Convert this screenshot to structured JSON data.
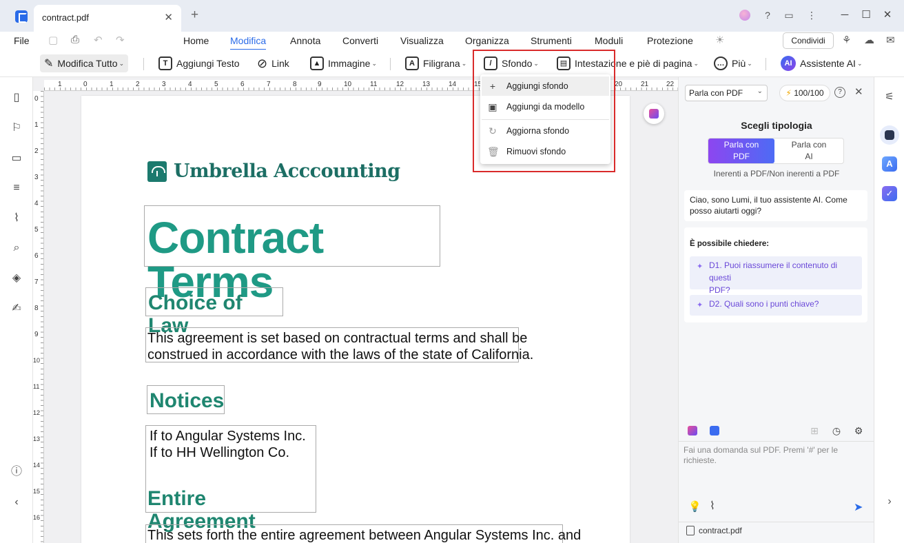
{
  "window": {
    "tab_title": "contract.pdf",
    "tab_close": "✕",
    "tab_add": "+"
  },
  "menu": {
    "file": "File",
    "items": [
      "Home",
      "Modifica",
      "Annota",
      "Converti",
      "Visualizza",
      "Organizza",
      "Strumenti",
      "Moduli",
      "Protezione"
    ],
    "active": "Modifica",
    "share": "Condividi"
  },
  "toolbar": {
    "edit_all": "Modifica Tutto",
    "add_text": "Aggiungi Testo",
    "link": "Link",
    "image": "Immagine",
    "watermark": "Filigrana",
    "background": "Sfondo",
    "header_footer": "Intestazione e piè di pagina",
    "more": "Più",
    "ai_badge": "AI",
    "ai_assistant": "Assistente AI"
  },
  "dropdown": {
    "items": [
      "Aggiungi sfondo",
      "Aggiungi da modello",
      "Aggiorna sfondo",
      "Rimuovi sfondo"
    ]
  },
  "ruler": {
    "h_labels": [
      "1",
      "0",
      "1",
      "2",
      "3",
      "4",
      "5",
      "6",
      "7",
      "8",
      "9",
      "10",
      "11",
      "12",
      "13",
      "14",
      "15",
      "20",
      "21",
      "22"
    ],
    "v_labels": [
      "0",
      "1",
      "2",
      "3",
      "4",
      "5",
      "6",
      "7",
      "8",
      "9",
      "10",
      "11",
      "12",
      "13",
      "14",
      "15",
      "16"
    ]
  },
  "document": {
    "brand": "Umbrella Acccounting",
    "title": "Contract Terms",
    "section1_heading": "Choice of Law",
    "section1_line1": "This agreement is set based on contractual terms and shall be",
    "section1_line2": "construed in accordance with the laws of the state of California.",
    "section2_heading": "Notices",
    "section2_line1": "If to Angular Systems Inc.",
    "section2_line2": "If to HH Wellington Co.",
    "section3_heading": "Entire Agreement",
    "section3_line1": "This sets forth the entire agreement between Angular Systems Inc. and"
  },
  "ai_panel": {
    "mode_select": "Parla con PDF",
    "credits": "100/100",
    "choose_type": "Scegli tipologia",
    "seg_a_line1": "Parla con",
    "seg_a_line2": "PDF",
    "seg_b_line1": "Parla con",
    "seg_b_line2": "AI",
    "subnote": "Inerenti a PDF/Non inerenti a PDF",
    "greeting_line1": "Ciao, sono Lumi, il tuo assistente AI. Come",
    "greeting_line2": "posso aiutarti oggi?",
    "can_ask": "È possibile chiedere:",
    "suggestion1_line1": "D1. Puoi riassumere il contenuto di questi",
    "suggestion1_line2": "PDF?",
    "suggestion2": "D2. Quali sono i punti chiave?",
    "input_placeholder_line1": "Fai una domanda sul PDF. Premi '#' per le",
    "input_placeholder_line2": "richieste.",
    "file_name": "contract.pdf"
  },
  "colors": {
    "accent": "#2a6be8",
    "brand_green": "#1c6e64",
    "title_teal": "#1f9a85",
    "highlight_red": "#d92a2a",
    "ai_gradient_start": "#8d46f0",
    "ai_gradient_end": "#4d6bf5"
  }
}
